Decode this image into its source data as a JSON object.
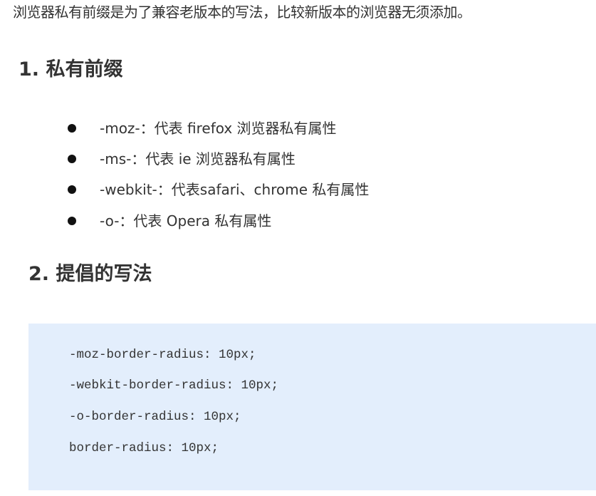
{
  "intro": "浏览器私有前缀是为了兼容老版本的写法，比较新版本的浏览器无须添加。",
  "section1": {
    "title": "1. 私有前缀",
    "items": [
      "-moz-：代表 firefox 浏览器私有属性",
      "-ms-：代表 ie 浏览器私有属性",
      "-webkit-：代表safari、chrome 私有属性",
      "-o-：代表 Opera 私有属性"
    ]
  },
  "section2": {
    "title": "2. 提倡的写法",
    "code": [
      "-moz-border-radius: 10px;",
      "-webkit-border-radius: 10px;",
      "-o-border-radius: 10px;",
      "border-radius: 10px;"
    ]
  }
}
